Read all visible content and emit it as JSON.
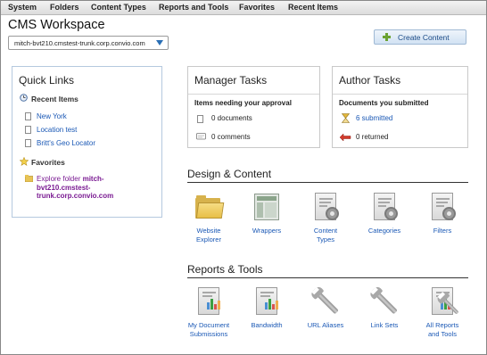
{
  "menu": [
    "System",
    "Folders",
    "Content Types",
    "Reports and Tools",
    "Favorites",
    "Recent Items"
  ],
  "workspace_title": "CMS Workspace",
  "site_selector": "mitch-bvt210.cmstest-trunk.corp.convio.com",
  "create_button": "Create Content",
  "quick_links": {
    "title": "Quick Links",
    "recent_heading": "Recent Items",
    "recent_items": [
      "New York",
      "Location test",
      "Britt's Geo Locator"
    ],
    "favorites_heading": "Favorites",
    "favorite_prefix": "Explore folder ",
    "favorite_folder": "mitch-bvt210.cmstest-trunk.corp.convio.com"
  },
  "manager_tasks": {
    "title": "Manager Tasks",
    "subtitle": "Items needing your approval",
    "documents": "0 documents",
    "comments": "0 comments"
  },
  "author_tasks": {
    "title": "Author Tasks",
    "subtitle": "Documents you submitted",
    "submitted": "6 submitted",
    "returned": "0 returned"
  },
  "design_content": {
    "title": "Design & Content",
    "items": [
      "Website Explorer",
      "Wrappers",
      "Content Types",
      "Categories",
      "Filters"
    ]
  },
  "reports_tools": {
    "title": "Reports & Tools",
    "items": [
      "My Document Submissions",
      "Bandwidth",
      "URL Aliases",
      "Link Sets",
      "All Reports and Tools"
    ]
  }
}
